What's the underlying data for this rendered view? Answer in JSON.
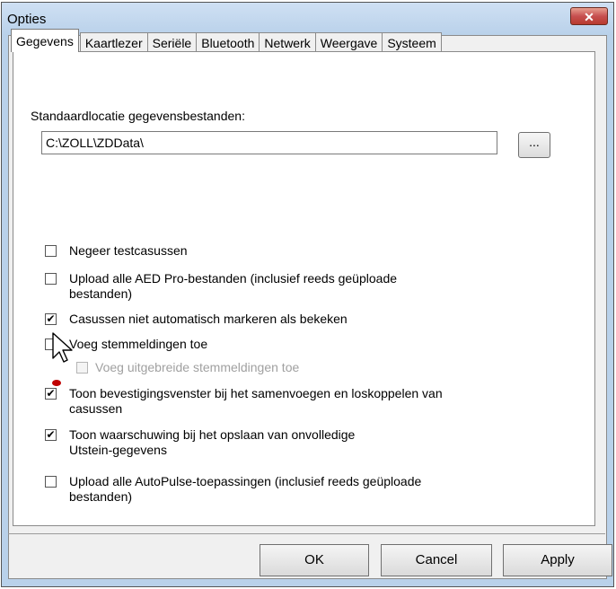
{
  "window": {
    "title": "Opties",
    "close_label": "✕"
  },
  "tabs": [
    {
      "label": "Gegevens",
      "active": true
    },
    {
      "label": "Kaartlezer"
    },
    {
      "label": "Seriële"
    },
    {
      "label": "Bluetooth"
    },
    {
      "label": "Netwerk"
    },
    {
      "label": "Weergave"
    },
    {
      "label": "Systeem"
    }
  ],
  "data_location": {
    "label": "Standaardlocatie gegevensbestanden:",
    "value": "C:\\ZOLL\\ZDData\\",
    "browse_label": "..."
  },
  "options": [
    {
      "line1": "Negeer testcasussen",
      "line2": "",
      "checked": false,
      "disabled": false
    },
    {
      "line1": "Upload alle AED Pro-bestanden (inclusief reeds geüploade",
      "line2": "bestanden)",
      "checked": false,
      "disabled": false
    },
    {
      "line1": "Casussen niet automatisch markeren als bekeken",
      "line2": "",
      "checked": true,
      "disabled": false
    },
    {
      "line1": "Voeg stemmeldingen toe",
      "line2": "",
      "checked": false,
      "disabled": false
    },
    {
      "line1": "Voeg uitgebreide stemmeldingen toe",
      "line2": "",
      "checked": false,
      "disabled": true
    },
    {
      "line1": "Toon bevestigingsvenster bij het samenvoegen en loskoppelen van",
      "line2": "casussen",
      "checked": true,
      "disabled": false
    },
    {
      "line1": "Toon waarschuwing bij het opslaan van onvolledige",
      "line2": "Utstein-gegevens",
      "checked": true,
      "disabled": false
    },
    {
      "line1": "Upload alle AutoPulse-toepassingen (inclusief reeds geüploade",
      "line2": "bestanden)",
      "checked": false,
      "disabled": false
    }
  ],
  "buttons": {
    "ok": "OK",
    "cancel": "Cancel",
    "apply": "Apply"
  },
  "check_mark": "✔"
}
